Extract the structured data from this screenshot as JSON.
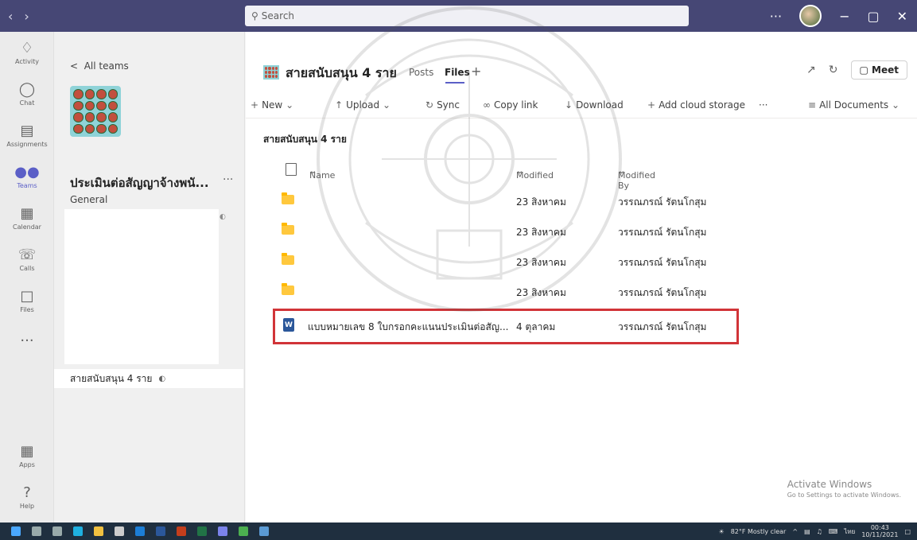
{
  "titlebar": {
    "search_placeholder": "Search",
    "more": "···",
    "minimize": "−",
    "maximize": "▢",
    "close": "✕"
  },
  "rail": {
    "items": [
      {
        "label": "Activity",
        "icon": "bell-icon"
      },
      {
        "label": "Chat",
        "icon": "chat-icon"
      },
      {
        "label": "Assignments",
        "icon": "assignments-icon"
      },
      {
        "label": "Teams",
        "icon": "teams-icon"
      },
      {
        "label": "Calendar",
        "icon": "calendar-icon"
      },
      {
        "label": "Calls",
        "icon": "phone-icon"
      },
      {
        "label": "Files",
        "icon": "file-icon"
      }
    ],
    "more": "···",
    "apps_label": "Apps",
    "help_label": "Help",
    "active_color": "#5b5fc7"
  },
  "panel": {
    "back_label": "All teams",
    "team_name": "ประเมินต่อสัญญาจ้างพนั...",
    "team_more": "···",
    "general_label": "General",
    "active_channel": "สายสนับสนุน 4 ราย"
  },
  "main": {
    "title": "สายสนับสนุน 4 ราย",
    "tabs": [
      {
        "label": "Posts"
      },
      {
        "label": "Files"
      }
    ],
    "meet_label": "Meet",
    "commands": {
      "new": "New",
      "upload": "Upload",
      "sync": "Sync",
      "copy_link": "Copy link",
      "download": "Download",
      "add_cloud": "Add cloud storage",
      "more": "···",
      "view": "All Documents"
    },
    "breadcrumb": "สายสนับสนุน 4 ราย",
    "columns": {
      "name": "Name",
      "modified": "Modified",
      "modified_by": "Modified By"
    },
    "rows": [
      {
        "type": "folder",
        "name": "",
        "modified": "23 สิงหาคม",
        "modified_by": "วรรณภรณ์ รัตนโกสุม"
      },
      {
        "type": "folder",
        "name": "",
        "modified": "23 สิงหาคม",
        "modified_by": "วรรณภรณ์ รัตนโกสุม"
      },
      {
        "type": "folder",
        "name": "",
        "modified": "23 สิงหาคม",
        "modified_by": "วรรณภรณ์ รัตนโกสุม"
      },
      {
        "type": "folder",
        "name": "",
        "modified": "23 สิงหาคม",
        "modified_by": "วรรณภรณ์ รัตนโกสุม"
      },
      {
        "type": "word",
        "name": "แบบหมายเลข 8 ใบกรอกคะแนนประเมินต่อสัญ...",
        "modified": "4 ตุลาคม",
        "modified_by": "วรรณภรณ์ รัตนโกสุม"
      }
    ],
    "highlight_color": "#d13438"
  },
  "activate": {
    "title": "Activate Windows",
    "subtitle": "Go to Settings to activate Windows."
  },
  "taskbar": {
    "weather": "82°F Mostly clear",
    "lang": "ไทย",
    "time": "00:43",
    "date": "10/11/2021"
  },
  "watermark_text": "ราชมงคลธัญบุรี"
}
